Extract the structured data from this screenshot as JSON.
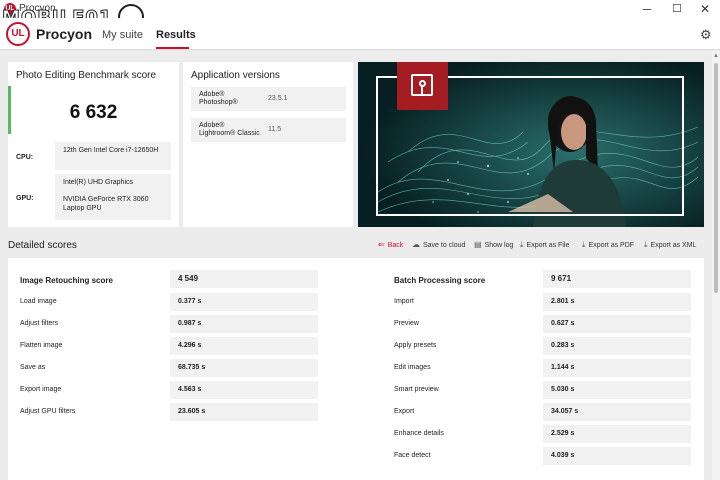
{
  "window": {
    "title": "Procyon",
    "watermark": "MOBILE01",
    "minimize_glyph": "─",
    "maximize_glyph": "☐",
    "close_glyph": "✕"
  },
  "nav": {
    "logo_text": "UL",
    "brand": "Procyon",
    "tabs": [
      {
        "label": "My suite",
        "active": false
      },
      {
        "label": "Results",
        "active": true
      }
    ],
    "accent_color": "#c8102e"
  },
  "score_card": {
    "title": "Photo Editing Benchmark score",
    "score": "6 632",
    "cpu_label": "CPU:",
    "cpu_value": "12th Gen Intel Core i7-12650H",
    "gpu_label": "GPU:",
    "gpu_values": [
      "Intel(R) UHD Graphics",
      "NVIDIA GeForce RTX 3060 Laptop GPU"
    ],
    "accent_color": "#5cb85c"
  },
  "app_versions": {
    "title": "Application versions",
    "apps": [
      {
        "name_line1": "Adobe®",
        "name_line2": "Photoshop®",
        "version": "23.5.1"
      },
      {
        "name_line1": "Adobe®",
        "name_line2": "Lightroom® Classic",
        "version": "11.5"
      }
    ]
  },
  "detailed": {
    "title": "Detailed scores",
    "actions": [
      {
        "label": "Back",
        "icon": "arrow-left-icon",
        "glyph": "⇐"
      },
      {
        "label": "Save to cloud",
        "icon": "cloud-icon",
        "glyph": "☁"
      },
      {
        "label": "Show log",
        "icon": "document-icon",
        "glyph": "▤"
      },
      {
        "label": "Export as File",
        "icon": "download-icon",
        "glyph": "⤓"
      },
      {
        "label": "Export as PDF",
        "icon": "download-icon",
        "glyph": "⤓"
      },
      {
        "label": "Export as XML",
        "icon": "download-icon",
        "glyph": "⤓"
      }
    ],
    "image_retouching": {
      "title": "Image Retouching score",
      "score": "4 549",
      "rows": [
        {
          "label": "Load image",
          "value": "0.377 s"
        },
        {
          "label": "Adjust filters",
          "value": "0.987 s"
        },
        {
          "label": "Flatten image",
          "value": "4.296 s"
        },
        {
          "label": "Save as",
          "value": "68.735 s"
        },
        {
          "label": "Export image",
          "value": "4.563 s"
        },
        {
          "label": "Adjust GPU filters",
          "value": "23.605 s"
        }
      ]
    },
    "batch_processing": {
      "title": "Batch Processing score",
      "score": "9 671",
      "rows": [
        {
          "label": "Import",
          "value": "2.801 s"
        },
        {
          "label": "Preview",
          "value": "0.627 s"
        },
        {
          "label": "Apply presets",
          "value": "0.283 s"
        },
        {
          "label": "Edit images",
          "value": "1.144 s"
        },
        {
          "label": "Smart preview",
          "value": "5.030 s"
        },
        {
          "label": "Export",
          "value": "34.057 s"
        },
        {
          "label": "Enhance details",
          "value": "2.529 s"
        },
        {
          "label": "Face detect",
          "value": "4.039 s"
        }
      ]
    }
  }
}
